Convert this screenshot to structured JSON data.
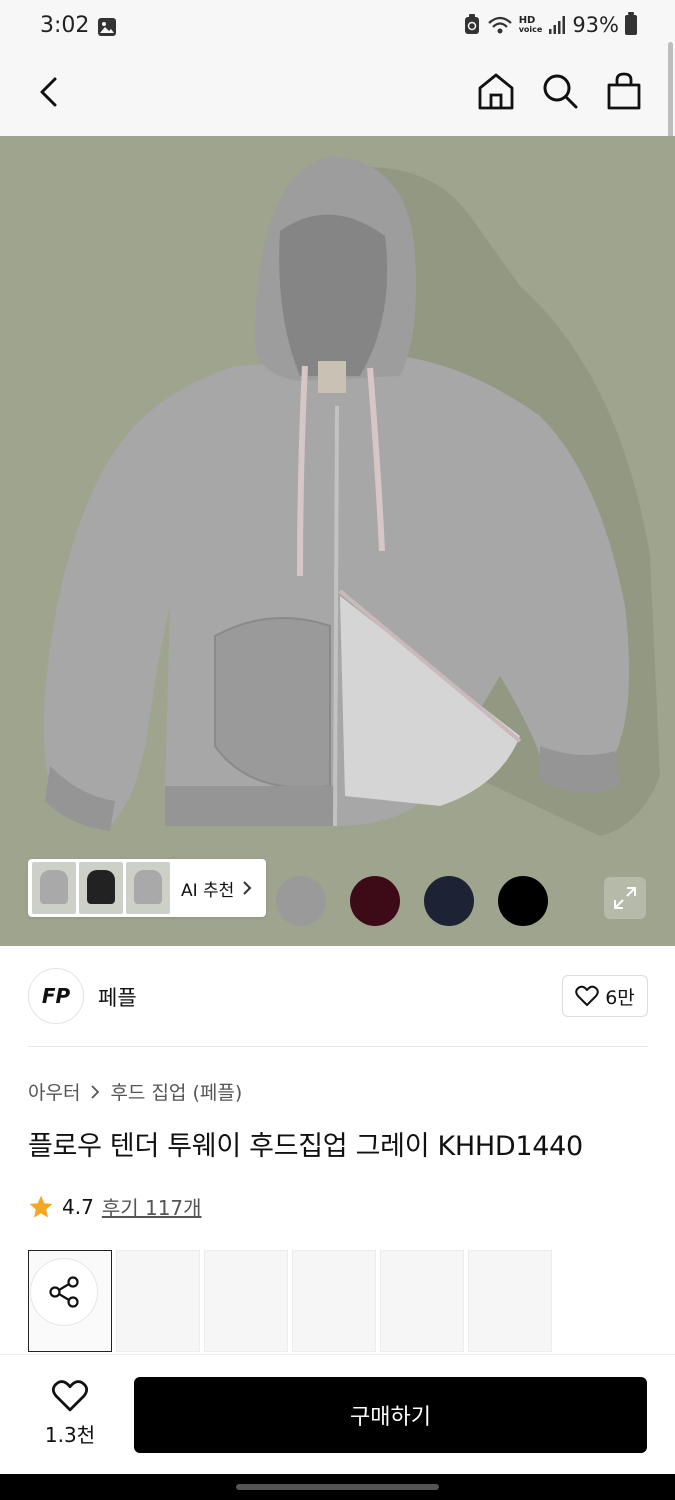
{
  "status": {
    "time": "3:02",
    "battery": "93%",
    "hd_label": "HD",
    "voice_label": "voice"
  },
  "nav": {
    "back_icon": "chevron-left-icon",
    "home_icon": "home-icon",
    "search_icon": "search-icon",
    "bag_icon": "shopping-bag-icon"
  },
  "hero": {
    "ai_label": "AI 추천",
    "swatches": [
      "#9a9a9a",
      "#3d0a17",
      "#1d2335",
      "#000000"
    ]
  },
  "brand": {
    "logo": "FP",
    "name": "페플",
    "likes": "6만"
  },
  "breadcrumb": {
    "category": "아우터",
    "subcategory": "후드 집업 (페플)"
  },
  "product": {
    "title": "플로우 텐더 투웨이 후드집업 그레이 KHHD1440",
    "rating": "4.7",
    "reviews": "후기 117개"
  },
  "bottom": {
    "wish_count": "1.3천",
    "buy_label": "구매하기"
  },
  "colors": {
    "accent": "#f5a623",
    "buy_bg": "#000000"
  }
}
